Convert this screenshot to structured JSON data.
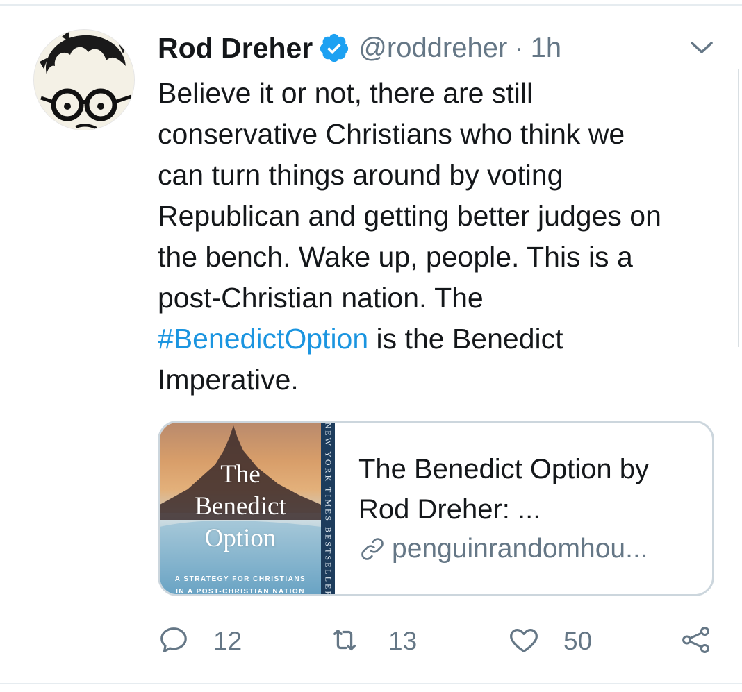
{
  "tweet": {
    "author_name": "Rod Dreher",
    "handle": "@roddreher",
    "separator": "·",
    "time": "1h",
    "text_lines": [
      "Believe it or not, there are still",
      "conservative Christians who think we",
      "can turn things around by voting",
      "Republican and getting better judges on",
      "the bench. Wake up, people. This is a",
      "post-Christian nation. The"
    ],
    "hashtag": "#BenedictOption",
    "after_hashtag": " is the Benedict",
    "last_line": "Imperative."
  },
  "card": {
    "cover_title_lines": [
      "The",
      "Benedict",
      "Option"
    ],
    "cover_subtitle_lines": [
      "A STRATEGY FOR CHRISTIANS",
      "IN A POST-CHRISTIAN NATION"
    ],
    "cover_spine": "NEW YORK TIMES BESTSELLER",
    "title_lines": [
      "The Benedict Option by",
      "Rod Dreher: ..."
    ],
    "link": "penguinrandomhou..."
  },
  "actions": {
    "replies": "12",
    "retweets": "13",
    "likes": "50"
  },
  "icons": [
    "verified-icon",
    "caret-down-icon",
    "link-icon",
    "reply-icon",
    "retweet-icon",
    "like-icon",
    "share-icon"
  ],
  "colors": {
    "link": "#1b95e0",
    "secondary": "#657786",
    "verified": "#1da1f2"
  }
}
